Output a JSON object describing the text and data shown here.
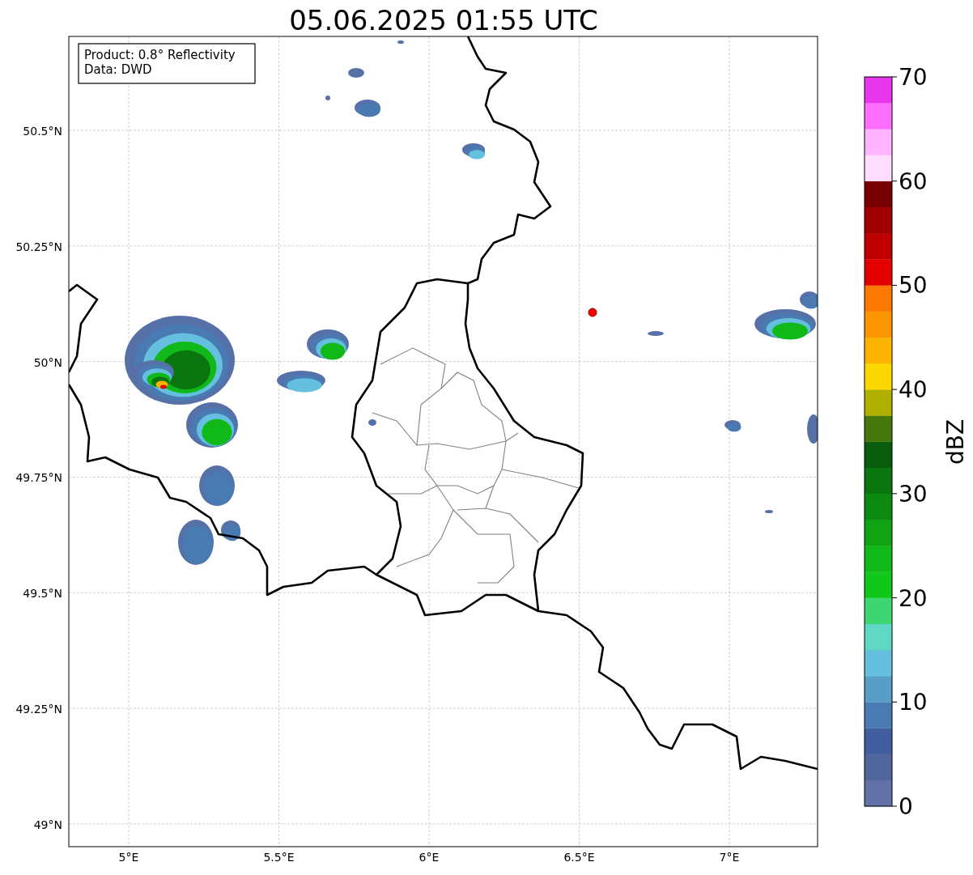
{
  "title": "05.06.2025 01:55 UTC",
  "info_box": {
    "lines": [
      "Product: 0.8° Reflectivity",
      "Data: DWD"
    ]
  },
  "map": {
    "x_ticks": [
      "5°E",
      "5.5°E",
      "6°E",
      "6.5°E",
      "7°E"
    ],
    "y_ticks": [
      "50.5°N",
      "50.25°N",
      "50°N",
      "49.75°N",
      "49.5°N",
      "49.25°N",
      "49°N"
    ]
  },
  "colorbar": {
    "label": "dBZ",
    "ticks": [
      "70",
      "60",
      "50",
      "40",
      "30",
      "20",
      "10",
      "0"
    ],
    "segments": [
      {
        "color": "#6272a6"
      },
      {
        "color": "#52669e"
      },
      {
        "color": "#405ea0"
      },
      {
        "color": "#4a7ab2"
      },
      {
        "color": "#5a9ec8"
      },
      {
        "color": "#64c0de"
      },
      {
        "color": "#60d8c4"
      },
      {
        "color": "#3ed672"
      },
      {
        "color": "#10c81a"
      },
      {
        "color": "#10b818"
      },
      {
        "color": "#10a414"
      },
      {
        "color": "#0c8a10"
      },
      {
        "color": "#0a7610"
      },
      {
        "color": "#085c0c"
      },
      {
        "color": "#46780c"
      },
      {
        "color": "#b0b000"
      },
      {
        "color": "#fcd800"
      },
      {
        "color": "#fcb400"
      },
      {
        "color": "#fc9600"
      },
      {
        "color": "#fc7800"
      },
      {
        "color": "#e40000"
      },
      {
        "color": "#c00000"
      },
      {
        "color": "#a00000"
      },
      {
        "color": "#780000"
      },
      {
        "color": "#fedcfe"
      },
      {
        "color": "#feb4fe"
      },
      {
        "color": "#fe6efe"
      },
      {
        "color": "#e836ee"
      }
    ]
  }
}
